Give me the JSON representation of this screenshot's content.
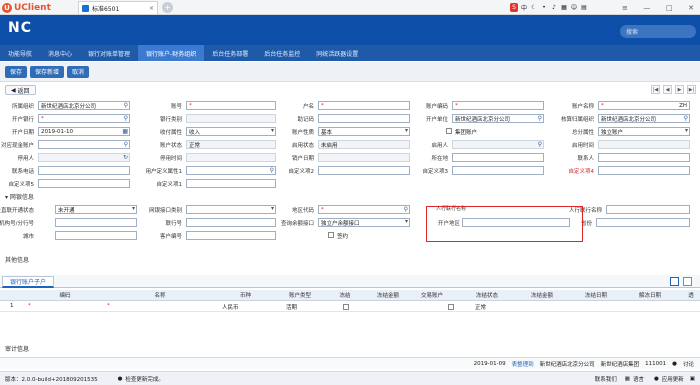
{
  "titlebar": {
    "app": "UClient",
    "tab": "标准6501",
    "close": "×",
    "plus": "+"
  },
  "header": {
    "logo": "NC",
    "search_placeholder": "搜索"
  },
  "nav": [
    {
      "label": "功能导航"
    },
    {
      "label": "消息中心"
    },
    {
      "label": "银行对账单管理"
    },
    {
      "label": "银行账户-财务组织",
      "active": true
    },
    {
      "label": "后台任务部署"
    },
    {
      "label": "后台任务监控"
    },
    {
      "label": "同统活跃器设置"
    }
  ],
  "toolbar": {
    "save": "保存",
    "save_add": "保存新增",
    "cancel": "取消"
  },
  "back": "返回",
  "form": {
    "r1": {
      "l1": "所属组织",
      "v1": "新世纪酒店北京分公司",
      "l2": "账号",
      "l3": "户名",
      "l4": "账户编码",
      "l5": "账户名称",
      "v5": "ZH"
    },
    "r2": {
      "l1": "开户银行",
      "l2": "银行类别",
      "l3": "助记码",
      "l4": "开户单位",
      "v4": "新世纪酒店北京分公司",
      "l5": "核算归属组织",
      "v5": "新世纪酒店北京分公司"
    },
    "r3": {
      "l1": "开户日期",
      "v1": "2019-01-10",
      "l2": "收付属性",
      "v2": "收入",
      "l3": "账户性质",
      "v3": "基本",
      "l4": "集团账户",
      "l5": "总分属性",
      "v5": "独立账户"
    },
    "r4": {
      "l1": "对应现金账户",
      "l2": "账户状态",
      "v2": "正常",
      "l3": "启用状态",
      "v3": "未启用",
      "l4": "启用人",
      "l5": "启用时间"
    },
    "r5": {
      "l1": "停用人",
      "l2": "停用时间",
      "l3": "销户日期",
      "l4": "所在地",
      "l5": "联系人"
    },
    "r6": {
      "l1": "联系电话",
      "l2": "用户定义属性1",
      "l3": "自定义项2",
      "l4": "自定义项3",
      "l5": "自定义项4"
    },
    "r7": {
      "l1": "自定义项5",
      "l2": "自定义项1"
    },
    "sec_bank": "网银信息",
    "b1": {
      "l1": "银企直联开通状态",
      "v1": "未开通",
      "l2": "网银接口类别",
      "l3": "地区代码",
      "l4": "人行联行名称",
      "l5": "人行联行名称"
    },
    "b2": {
      "l1": "机构号/分行号",
      "l2": "联行号",
      "l3": "查询余额接口",
      "v3": "独立户余额接口",
      "l4": "开户地区",
      "l5": "省份"
    },
    "b3": {
      "l1": "城市",
      "l2": "客户编号",
      "l3": "签约"
    },
    "sec_other": "其他信息"
  },
  "grid": {
    "tab": "银行账户子户",
    "headers": [
      "编码",
      "名称",
      "币种",
      "账户类型",
      "冻结",
      "冻结金额",
      "交易账户",
      "冻结状态",
      "冻结金额",
      "冻结日期",
      "解冻日期",
      "透"
    ],
    "row": {
      "idx": "1",
      "currency": "人民币",
      "type": "活期",
      "status": "正常"
    }
  },
  "audit": "审计信息",
  "status1": {
    "date": "2019-01-09",
    "tmpl": "表整理到",
    "org": "新世纪酒店北京分公司",
    "group": "新世纪酒店集团",
    "code": "111001",
    "user": "讨论"
  },
  "status2": {
    "version": "版本：2.0.0-build+201809201535",
    "msg": "检查更新完成。",
    "contact": "联系我们",
    "env": "语言",
    "app_update": "应用更新"
  }
}
